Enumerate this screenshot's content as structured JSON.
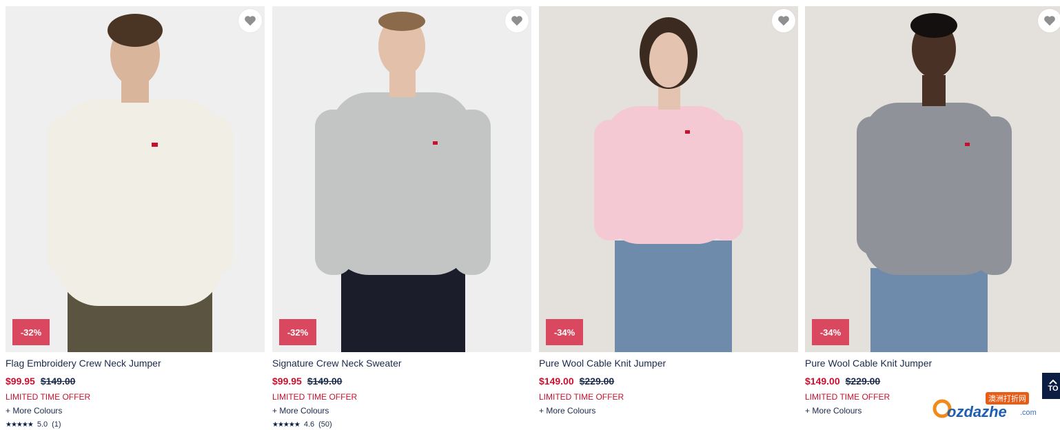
{
  "products": [
    {
      "name": "Flag Embroidery Crew Neck Jumper",
      "sale_price": "$99.95",
      "original_price": "$149.00",
      "discount": "-32%",
      "offer": "LIMITED TIME OFFER",
      "more_colours": "+ More Colours",
      "rating_stars": "★★★★★",
      "rating_value": "5.0",
      "rating_count": "(1)",
      "sweater_color": "#f1eee6",
      "bottom_color": "#5a5440",
      "skin_color": "#d9b59c",
      "hair_color": "#4a3525"
    },
    {
      "name": "Signature Crew Neck Sweater",
      "sale_price": "$99.95",
      "original_price": "$149.00",
      "discount": "-32%",
      "offer": "LIMITED TIME OFFER",
      "more_colours": "+ More Colours",
      "rating_stars": "★★★★★",
      "rating_value": "4.6",
      "rating_count": "(50)",
      "sweater_color": "#c3c4c4",
      "bottom_color": "#1b1e2a",
      "skin_color": "#e2c0aa",
      "hair_color": "#8a6a4a"
    },
    {
      "name": "Pure Wool Cable Knit Jumper",
      "sale_price": "$149.00",
      "original_price": "$229.00",
      "discount": "-34%",
      "offer": "LIMITED TIME OFFER",
      "more_colours": "+ More Colours",
      "sweater_color": "#f4c9d3",
      "bottom_color": "#6f8bab",
      "skin_color": "#e4c4b0",
      "hair_color": "#3a2a20"
    },
    {
      "name": "Pure Wool Cable Knit Jumper",
      "sale_price": "$149.00",
      "original_price": "$229.00",
      "discount": "-34%",
      "offer": "LIMITED TIME OFFER",
      "more_colours": "+ More Colours",
      "sweater_color": "#8f9299",
      "bottom_color": "#6f8bab",
      "skin_color": "#4a3125",
      "hair_color": "#141010"
    }
  ],
  "back_to_top": "TO",
  "watermark": {
    "text": "ozdazhe",
    "domain": ".com",
    "cn_label": "澳洲打折网"
  },
  "colors": {
    "sale_red": "#c8102e",
    "badge_red": "#d9485f",
    "navy": "#0b1d43"
  }
}
